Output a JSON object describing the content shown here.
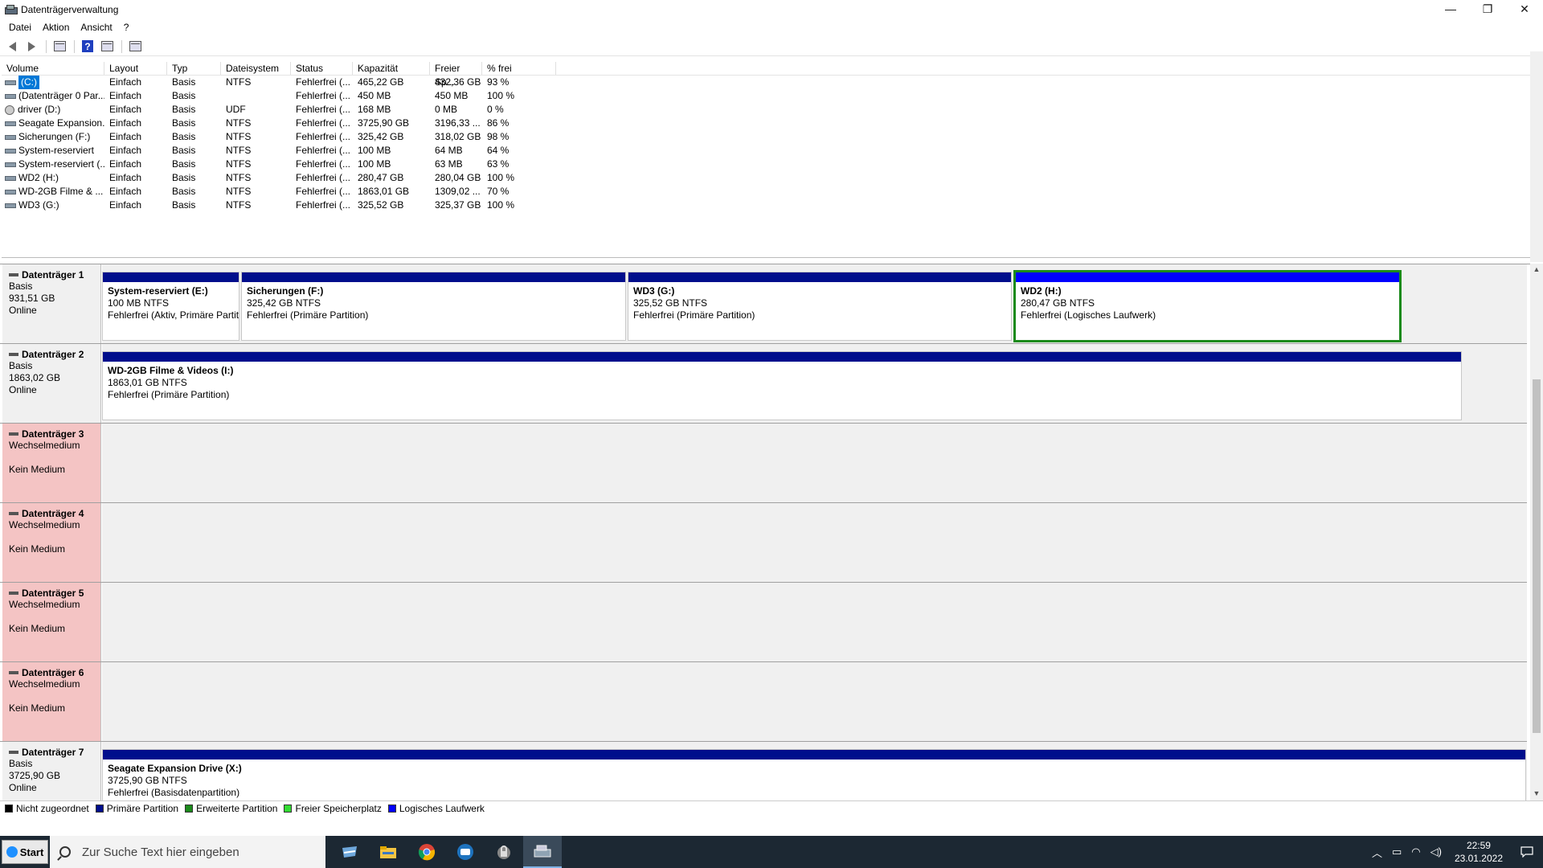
{
  "window": {
    "title": "Datenträgerverwaltung",
    "controls": {
      "minimize": "—",
      "restore": "❐",
      "close": "✕"
    }
  },
  "menu": [
    "Datei",
    "Aktion",
    "Ansicht",
    "?"
  ],
  "volume_list": {
    "columns": [
      "Volume",
      "Layout",
      "Typ",
      "Dateisystem",
      "Status",
      "Kapazität",
      "Freier Sp...",
      "% frei"
    ],
    "rows": [
      [
        "(C:)",
        "Einfach",
        "Basis",
        "NTFS",
        "Fehlerfrei (...",
        "465,22 GB",
        "432,36 GB",
        "93 %"
      ],
      [
        "(Datenträger 0 Par...",
        "Einfach",
        "Basis",
        "",
        "Fehlerfrei (...",
        "450 MB",
        "450 MB",
        "100 %"
      ],
      [
        "driver (D:)",
        "Einfach",
        "Basis",
        "UDF",
        "Fehlerfrei (...",
        "168 MB",
        "0 MB",
        "0 %"
      ],
      [
        "Seagate Expansion...",
        "Einfach",
        "Basis",
        "NTFS",
        "Fehlerfrei (...",
        "3725,90 GB",
        "3196,33 ...",
        "86 %"
      ],
      [
        "Sicherungen (F:)",
        "Einfach",
        "Basis",
        "NTFS",
        "Fehlerfrei (...",
        "325,42 GB",
        "318,02 GB",
        "98 %"
      ],
      [
        "System-reserviert",
        "Einfach",
        "Basis",
        "NTFS",
        "Fehlerfrei (...",
        "100 MB",
        "64 MB",
        "64 %"
      ],
      [
        "System-reserviert (...",
        "Einfach",
        "Basis",
        "NTFS",
        "Fehlerfrei (...",
        "100 MB",
        "63 MB",
        "63 %"
      ],
      [
        "WD2 (H:)",
        "Einfach",
        "Basis",
        "NTFS",
        "Fehlerfrei (...",
        "280,47 GB",
        "280,04 GB",
        "100 %"
      ],
      [
        "WD-2GB Filme & ...",
        "Einfach",
        "Basis",
        "NTFS",
        "Fehlerfrei (...",
        "1863,01 GB",
        "1309,02 ...",
        "70 %"
      ],
      [
        "WD3 (G:)",
        "Einfach",
        "Basis",
        "NTFS",
        "Fehlerfrei (...",
        "325,52 GB",
        "325,37 GB",
        "100 %"
      ]
    ]
  },
  "disks": [
    {
      "name": "Datenträger 1",
      "line1": "Basis",
      "line2": "931,51 GB",
      "line3": "Online",
      "partitions": [
        {
          "name": "System-reserviert  (E:)",
          "size": "100 MB NTFS",
          "status": "Fehlerfrei (Aktiv, Primäre Partition)"
        },
        {
          "name": "Sicherungen  (F:)",
          "size": "325,42 GB NTFS",
          "status": "Fehlerfrei (Primäre Partition)"
        },
        {
          "name": "WD3  (G:)",
          "size": "325,52 GB NTFS",
          "status": "Fehlerfrei (Primäre Partition)"
        },
        {
          "name": "WD2  (H:)",
          "size": "280,47 GB NTFS",
          "status": "Fehlerfrei (Logisches Laufwerk)"
        }
      ]
    },
    {
      "name": "Datenträger 2",
      "line1": "Basis",
      "line2": "1863,02 GB",
      "line3": "Online",
      "partitions": [
        {
          "name": "WD-2GB Filme & Videos  (I:)",
          "size": "1863,01 GB NTFS",
          "status": "Fehlerfrei (Primäre Partition)"
        }
      ]
    },
    {
      "name": "Datenträger 3",
      "line1": "Wechselmedium",
      "line2": "",
      "line3": "Kein Medium"
    },
    {
      "name": "Datenträger 4",
      "line1": "Wechselmedium",
      "line2": "",
      "line3": "Kein Medium"
    },
    {
      "name": "Datenträger 5",
      "line1": "Wechselmedium",
      "line2": "",
      "line3": "Kein Medium"
    },
    {
      "name": "Datenträger 6",
      "line1": "Wechselmedium",
      "line2": "",
      "line3": "Kein Medium"
    },
    {
      "name": "Datenträger 7",
      "line1": "Basis",
      "line2": "3725,90 GB",
      "line3": "Online",
      "partitions": [
        {
          "name": "Seagate Expansion Drive  (X:)",
          "size": "3725,90 GB NTFS",
          "status": "Fehlerfrei (Basisdatenpartition)"
        }
      ]
    }
  ],
  "legend": [
    {
      "label": "Nicht zugeordnet",
      "color": "#000000"
    },
    {
      "label": "Primäre Partition",
      "color": "#000e8c"
    },
    {
      "label": "Erweiterte Partition",
      "color": "#1b8a1b"
    },
    {
      "label": "Freier Speicherplatz",
      "color": "#33dd33"
    },
    {
      "label": "Logisches Laufwerk",
      "color": "#0000ff"
    }
  ],
  "taskbar": {
    "start_label": "Start",
    "search_placeholder": "Zur Suche Text hier eingeben",
    "time": "22:59",
    "date": "23.01.2022"
  }
}
